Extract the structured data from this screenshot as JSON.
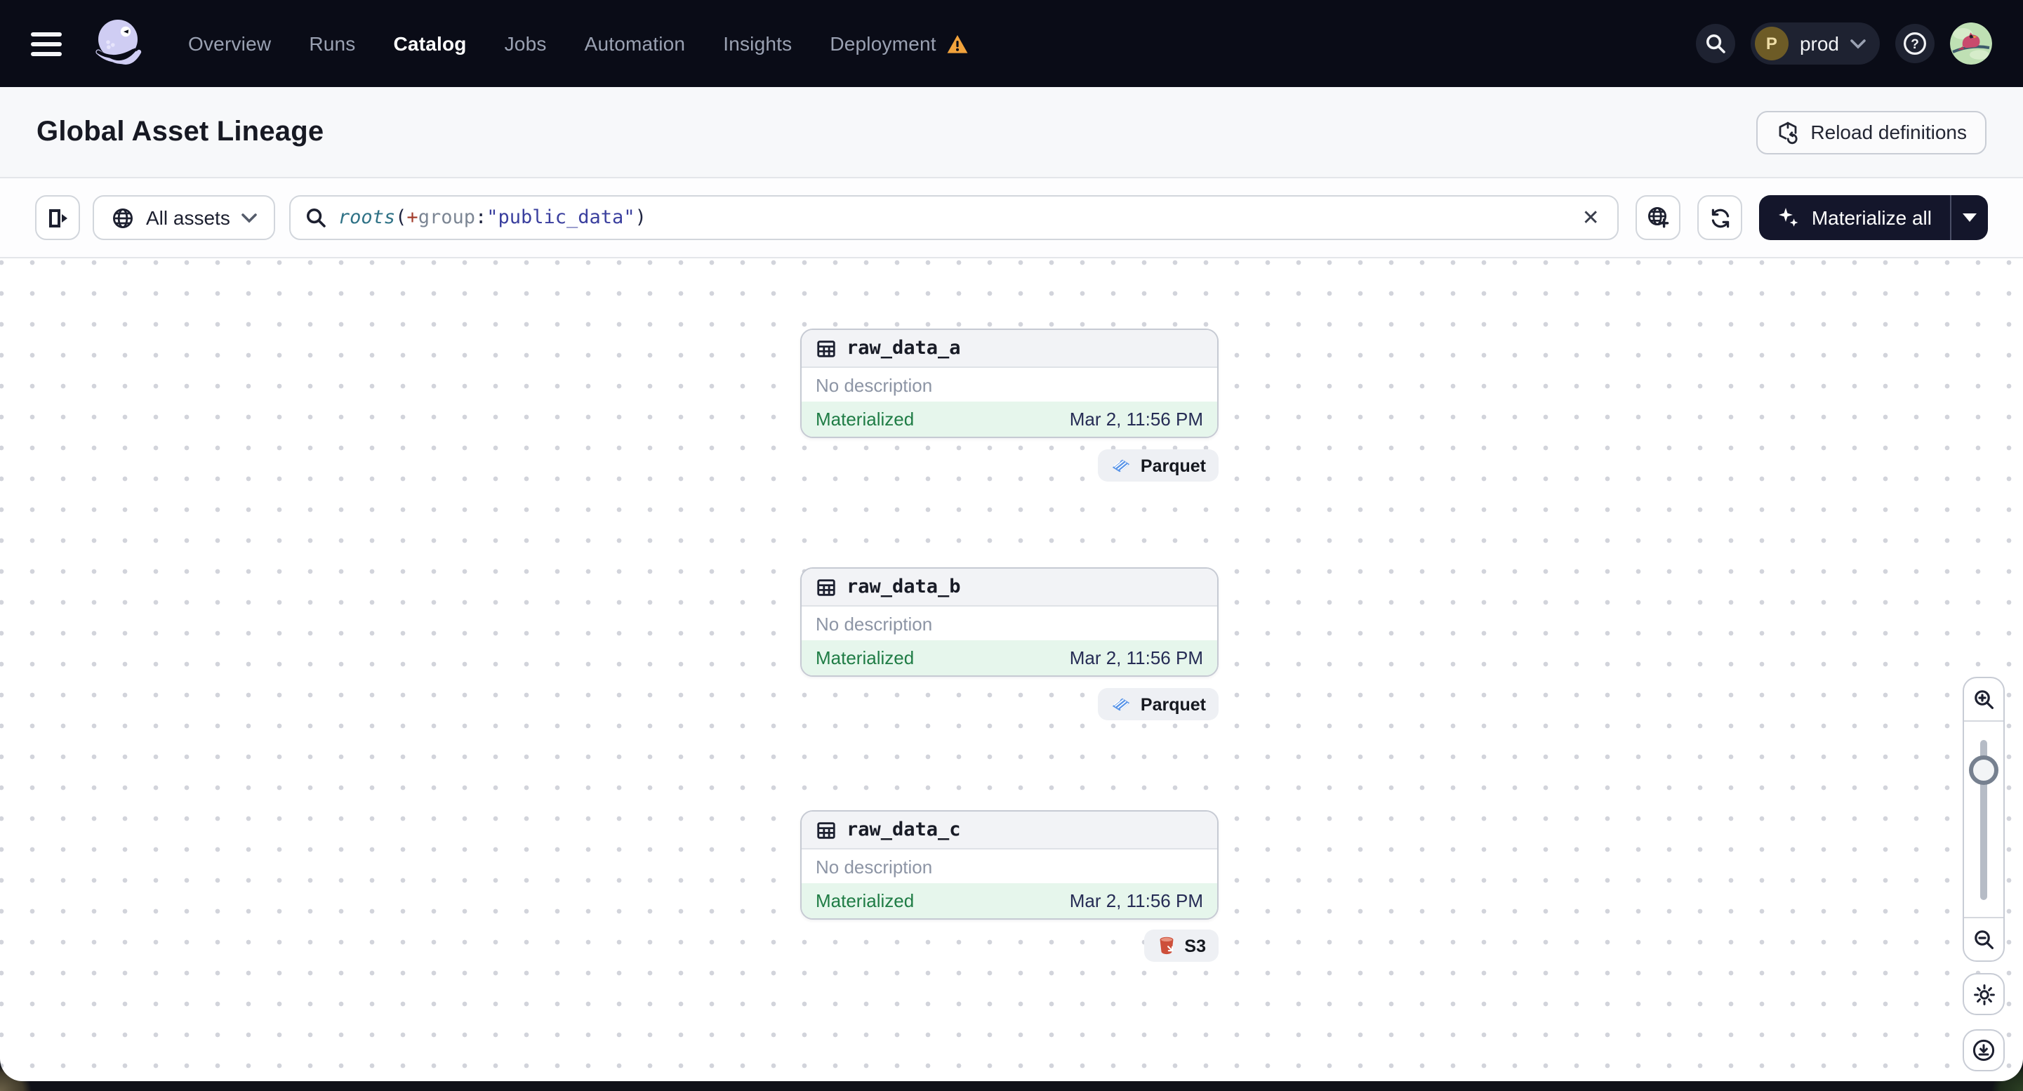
{
  "navbar": {
    "items": [
      {
        "label": "Overview"
      },
      {
        "label": "Runs"
      },
      {
        "label": "Catalog",
        "active": true
      },
      {
        "label": "Jobs"
      },
      {
        "label": "Automation"
      },
      {
        "label": "Insights"
      },
      {
        "label": "Deployment",
        "has_warning": true
      }
    ],
    "workspace": {
      "avatar_letter": "P",
      "label": "prod"
    }
  },
  "header": {
    "title": "Global Asset Lineage",
    "reload_button_label": "Reload definitions"
  },
  "toolbar": {
    "scope_filter_label": "All assets",
    "query": {
      "segments": [
        {
          "text": "roots",
          "type": "function"
        },
        {
          "text": "(",
          "type": "paren"
        },
        {
          "text": "+",
          "type": "operator"
        },
        {
          "text": "group",
          "type": "attribute"
        },
        {
          "text": ":",
          "type": "paren"
        },
        {
          "text": "\"public_data\"",
          "type": "string"
        },
        {
          "text": ")",
          "type": "paren"
        }
      ]
    },
    "materialize_button_label": "Materialize all"
  },
  "graph": {
    "nodes": [
      {
        "name": "raw_data_a",
        "description": "No description",
        "status": "Materialized",
        "timestamp": "Mar 2, 11:56 PM",
        "tag": "Parquet",
        "tag_icon": "parquet-icon"
      },
      {
        "name": "raw_data_b",
        "description": "No description",
        "status": "Materialized",
        "timestamp": "Mar 2, 11:56 PM",
        "tag": "Parquet",
        "tag_icon": "parquet-icon"
      },
      {
        "name": "raw_data_c",
        "description": "No description",
        "status": "Materialized",
        "timestamp": "Mar 2, 11:56 PM",
        "tag": "S3",
        "tag_icon": "s3-bucket-icon"
      }
    ]
  },
  "colors": {
    "navbar_bg": "#0a0c17",
    "materialize_bg": "#14162b",
    "status_green": "#1f7c45",
    "status_bg": "#e6f6ec",
    "timestamp_navy": "#262c55",
    "warning_amber": "#f2a33c",
    "parquet_blue": "#5a95e8",
    "s3_red": "#cd4f3a",
    "query_function": "#2f7286",
    "query_operator": "#a33d2c",
    "query_attribute": "#7c8694",
    "query_string": "#3a3f9e"
  }
}
